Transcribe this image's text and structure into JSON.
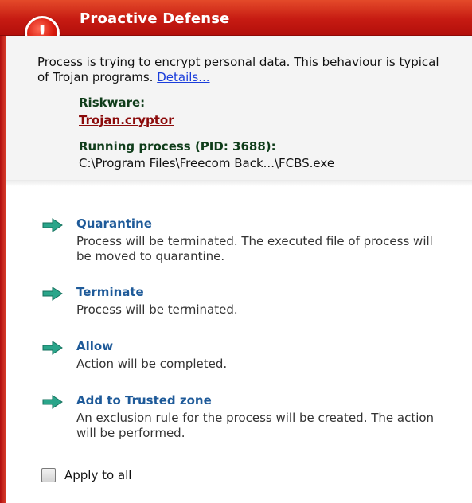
{
  "window": {
    "title": "Proactive Defense",
    "accent_color": "#c61b12",
    "alert_icon_glyph": "!"
  },
  "message": {
    "text": "Process is trying to encrypt personal data. This behaviour is typical of Trojan programs.",
    "details_link": "Details..."
  },
  "threat": {
    "type_label": "Riskware:",
    "name": "Trojan.cryptor",
    "process_label": "Running process (PID: 3688):",
    "process_path": "C:\\Program Files\\Freecom Back...\\FCBS.exe"
  },
  "actions": [
    {
      "title": "Quarantine",
      "description": "Process will be terminated. The executed file of process will be moved to quarantine.",
      "icon": "green-arrow-icon"
    },
    {
      "title": "Terminate",
      "description": "Process will be terminated.",
      "icon": "green-arrow-icon"
    },
    {
      "title": "Allow",
      "description": "Action will be completed.",
      "icon": "green-arrow-icon"
    },
    {
      "title": "Add to Trusted zone",
      "description": "An exclusion rule for the process will be created. The action will be performed.",
      "icon": "green-arrow-icon"
    }
  ],
  "apply_to_all": {
    "label": "Apply to all",
    "checked": false
  }
}
